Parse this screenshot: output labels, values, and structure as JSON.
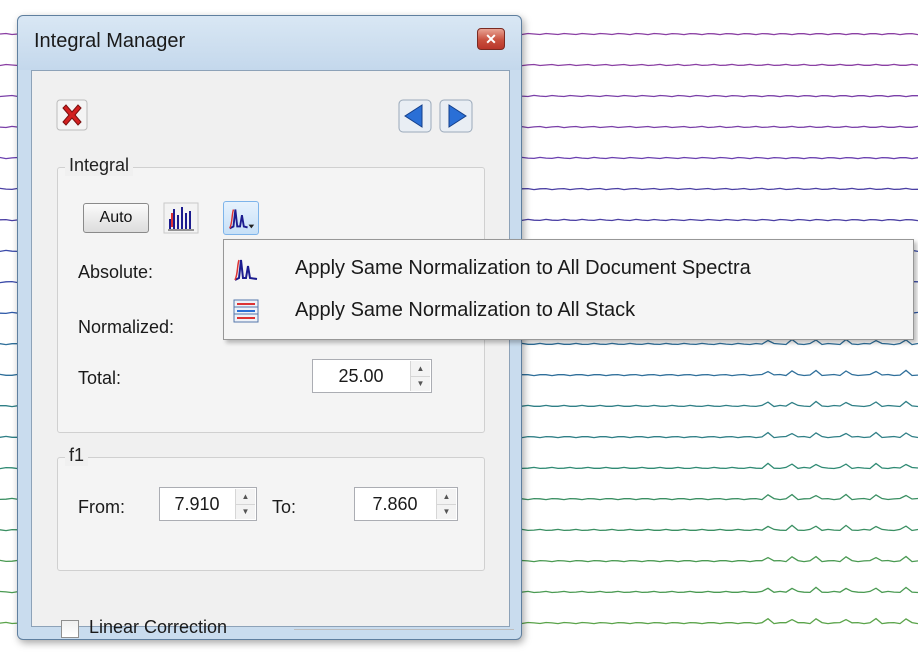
{
  "dialog": {
    "title": "Integral Manager",
    "close_label": "✕"
  },
  "integral": {
    "group_title": "Integral",
    "auto_label": "Auto",
    "absolute_label": "Absolute:",
    "normalized_label": "Normalized:",
    "total_label": "Total:",
    "total_value": "25.00"
  },
  "f1": {
    "group_title": "f1",
    "from_label": "From:",
    "from_value": "7.910",
    "to_label": "To:",
    "to_value": "7.860"
  },
  "linear_correction": {
    "label": "Linear Correction",
    "checked": false
  },
  "normalization_menu": {
    "items": [
      {
        "label": "Apply Same Normalization to All Document Spectra",
        "icon": "spectrum-peak-icon"
      },
      {
        "label": "Apply Same Normalization to All Stack",
        "icon": "stack-icon"
      }
    ]
  },
  "icons": {
    "delete": "delete-icon",
    "previous": "arrow-left-icon",
    "next": "arrow-right-icon",
    "spectrum_bars": "spectrum-bars-icon",
    "normalize_dropdown": "normalize-dropdown-icon"
  },
  "colors": {
    "dialog_frame": "#c9dcee",
    "close_button": "#c9503e",
    "delete_red": "#d32020",
    "nav_blue": "#2a6fd6",
    "pressed_highlight": "#c7e0f7",
    "spectra_traces": [
      "#8a3fa3",
      "#7a3fa8",
      "#6a3faf",
      "#4a3fa3",
      "#3a4aa8",
      "#2f5aa8",
      "#2f6f9a",
      "#2f7f86",
      "#2f8a73",
      "#3a8f62",
      "#4a9a52",
      "#5aa34a"
    ]
  }
}
